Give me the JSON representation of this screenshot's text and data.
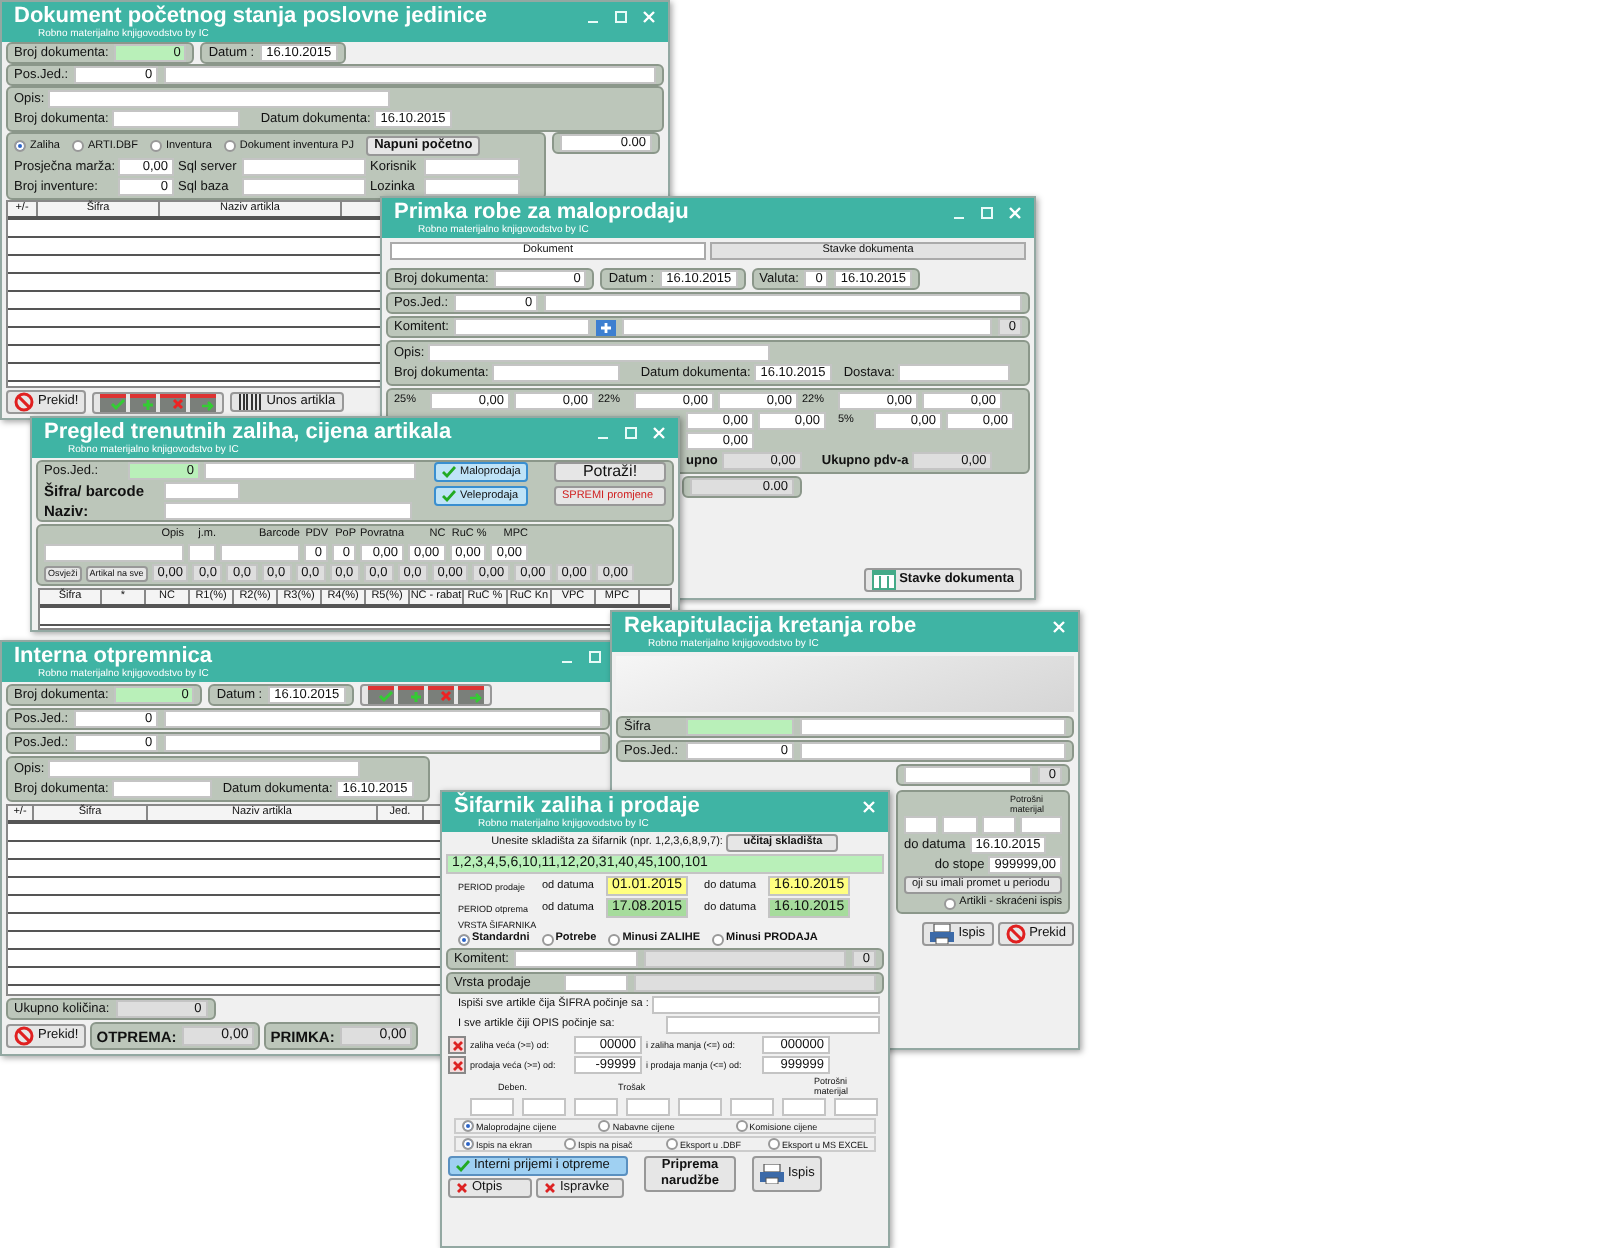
{
  "pocetno_stanje": {
    "title": "Dokument početnog stanja poslovne jedinice",
    "subtitle": "Robno materijalno knjigovodstvo by IC",
    "broj_dokumenta": {
      "label": "Broj dokumenta:",
      "value": "0"
    },
    "datum": {
      "label": "Datum :",
      "value": "16.10.2015"
    },
    "pos_jed": {
      "label": "Pos.Jed.:",
      "value": "0"
    },
    "opis_label": "Opis:",
    "broj_dok_label": "Broj dokumenta:",
    "datum_dok": {
      "label": "Datum dokumenta:",
      "value": "16.10.2015"
    },
    "options": [
      {
        "label": "Zaliha",
        "selected": true
      },
      {
        "label": "ARTI.DBF",
        "selected": false
      },
      {
        "label": "Inventura",
        "selected": false
      },
      {
        "label": "Dokument inventura PJ",
        "selected": false
      }
    ],
    "napuni_button": "Napuni početno",
    "total": "0.00",
    "marza": {
      "label": "Prosječna marža:",
      "value": "0,00"
    },
    "broj_inventure": {
      "label": "Broj inventure:",
      "value": "0"
    },
    "sql_server": "Sql server",
    "sql_baza": "Sql baza",
    "korisnik": "Korisnik",
    "lozinka": "Lozinka",
    "grid_columns": [
      "+/-",
      "Šifra",
      "Naziv artikla"
    ],
    "prekid_button": "Prekid!",
    "unos_button": "Unos artikla"
  },
  "primka": {
    "title": "Primka robe za maloprodaju",
    "subtitle": "Robno materijalno knjigovodstvo by IC",
    "tabs": [
      {
        "label": "Dokument",
        "selected": true
      },
      {
        "label": "Stavke dokumenta",
        "selected": false
      }
    ],
    "broj_dokumenta": {
      "label": "Broj dokumenta:",
      "value": "0"
    },
    "datum": {
      "label": "Datum :",
      "value": "16.10.2015"
    },
    "valuta": {
      "label": "Valuta:",
      "value": "0",
      "date": "16.10.2015"
    },
    "pos_jed": {
      "label": "Pos.Jed.:",
      "value": "0"
    },
    "komitent": {
      "label": "Komitent:",
      "value": "0"
    },
    "opis_label": "Opis:",
    "broj_dok_label": "Broj dokumenta:",
    "datum_dok": {
      "label": "Datum dokumenta:",
      "value": "16.10.2015"
    },
    "dostava_label": "Dostava:",
    "tax_top": [
      {
        "rate": "25%",
        "values": [
          "0,00",
          "0,00"
        ]
      },
      {
        "rate": "22%",
        "values": [
          "0,00",
          "0,00"
        ]
      },
      {
        "rate": "22%",
        "values": [
          "0,00",
          "0,00"
        ]
      }
    ],
    "tax_middle": [
      [
        "0,00",
        "0,00"
      ],
      [
        "0,00"
      ]
    ],
    "tax_right": {
      "rate": "5%",
      "values": [
        "0,00",
        "0,00"
      ]
    },
    "ukupno": {
      "label": "upno",
      "value": "0,00"
    },
    "ukupno_pdv": {
      "label": "Ukupno pdv-a",
      "value": "0,00"
    },
    "total": "0.00",
    "stavke_button": "Stavke dokumenta"
  },
  "pregled_zaliha": {
    "title": "Pregled trenutnih zaliha, cijena artikala",
    "subtitle": "Robno materijalno knjigovodstvo by IC",
    "pos_jed": {
      "label": "Pos.Jed.:",
      "value": "0"
    },
    "sifra_label": "Šifra/ barcode",
    "naziv_label": "Naziv:",
    "checks": [
      {
        "label": "Maloprodaja",
        "checked": true
      },
      {
        "label": "Veleprodaja",
        "checked": true
      }
    ],
    "potrazi_button": "Potraži!",
    "spremi_button": "SPREMI promjene",
    "fields": [
      {
        "label": "Opis"
      },
      {
        "label": "j.m."
      },
      {
        "label": "Barcode"
      },
      {
        "label": "PDV",
        "value": "0"
      },
      {
        "label": "PoP",
        "value": "0"
      },
      {
        "label": "Povratna",
        "value": "0,00"
      },
      {
        "label": "NC",
        "value": "0,00"
      },
      {
        "label": "RuC %",
        "value": "0,00"
      },
      {
        "label": "MPC",
        "value": "0,00"
      }
    ],
    "osvjezi_button": "Osvježi",
    "artikal_button": "Artikal na sve",
    "values": [
      "0,00",
      "0,0",
      "0,0",
      "0,0",
      "0,0",
      "0,0",
      "0,0",
      "0,0",
      "0,00",
      "0,00",
      "0,00",
      "0,00",
      "0,00"
    ],
    "grid_columns": [
      "Šifra",
      "*",
      "NC",
      "R1(%)",
      "R2(%)",
      "R3(%)",
      "R4(%)",
      "R5(%)",
      "NC - rabat",
      "RuC %",
      "RuC Kn",
      "VPC",
      "MPC"
    ]
  },
  "interna_otpremnica": {
    "title": "Interna otpremnica",
    "subtitle": "Robno materijalno knjigovodstvo by IC",
    "broj_dokumenta": {
      "label": "Broj dokumenta:",
      "value": "0"
    },
    "datum": {
      "label": "Datum :",
      "value": "16.10.2015"
    },
    "pos_jed": [
      {
        "label": "Pos.Jed.:",
        "value": "0"
      },
      {
        "label": "Pos.Jed.:",
        "value": "0"
      }
    ],
    "opis_label": "Opis:",
    "broj_dok_label": "Broj dokumenta:",
    "datum_dok": {
      "label": "Datum dokumenta:",
      "value": "16.10.2015"
    },
    "grid_columns": [
      "+/-",
      "Šifra",
      "Naziv artikla",
      "Jed."
    ],
    "ukupno": {
      "label": "Ukupno količina:",
      "value": "0"
    },
    "prekid_button": "Prekid!",
    "otprema": {
      "label": "OTPREMA:",
      "value": "0,00"
    },
    "primka": {
      "label": "PRIMKA:",
      "value": "0,00"
    }
  },
  "rekapitulacija": {
    "title": "Rekapitulacija kretanja robe",
    "subtitle": "Robno materijalno knjigovodstvo by IC",
    "sifra_label": "Šifra",
    "pos_jed": {
      "label": "Pos.Jed.:",
      "value": "0"
    },
    "komitent_value": "0",
    "potrosni_label": "Potrošni materijal",
    "do_datuma": {
      "label": "do datuma",
      "value": "16.10.2015"
    },
    "do_stope": {
      "label": "do stope",
      "value": "999999,00"
    },
    "promet_button": "oji su imali promet u periodu",
    "skraceni": {
      "label": "Artikli - skraćeni ispis",
      "selected": false
    },
    "ispis_button": "Ispis",
    "prekid_button": "Prekid"
  },
  "sifarnik": {
    "title": "Šifarnik zaliha i prodaje",
    "subtitle": "Robno materijalno knjigovodstvo by IC",
    "skladista_label": "Unesite skladišta za šifarnik (npr. 1,2,3,6,8,9,7):",
    "ucitaj_button": "učitaj skladišta",
    "skladista_value": "1,2,3,4,5,6,10,11,12,20,31,40,45,100,101",
    "periods": [
      {
        "label": "PERIOD prodaje",
        "od_label": "od datuma",
        "od": "01.01.2015",
        "do_label": "do datuma",
        "do": "16.10.2015",
        "color": "#ffff80"
      },
      {
        "label": "PERIOD otprema",
        "od_label": "od datuma",
        "od": "17.08.2015",
        "do_label": "do datuma",
        "do": "16.10.2015",
        "color": "#a6dc9c"
      }
    ],
    "vrsta_label": "VRSTA ŠIFARNIKA",
    "vrsta": [
      {
        "label": "Standardni",
        "selected": true
      },
      {
        "label": "Potrebe",
        "selected": false
      },
      {
        "label": "Minusi ZALIHE",
        "selected": false
      },
      {
        "label": "Minusi PRODAJA",
        "selected": false
      }
    ],
    "komitent": {
      "label": "Komitent:",
      "value": "0"
    },
    "vrsta_prodaje_label": "Vrsta prodaje",
    "ispisi_sifra_label": "Ispiši sve artikle čija ŠIFRA počinje sa :",
    "ispisi_opis_label": "I  sve artikle čiji OPIS počinje sa:",
    "filters": [
      {
        "checked": true,
        "label": "zaliha veća (>=) od:",
        "value": "00000",
        "label2": "i zaliha manja (<=) od:",
        "value2": "000000"
      },
      {
        "checked": true,
        "label": "prodaja  veća (>=) od:",
        "value": "-99999",
        "label2": "i prodaja manja (<=) od:",
        "value2": "999999"
      }
    ],
    "small_labels": [
      "Deben.",
      "Trošak",
      "Potrošni materijal"
    ],
    "cijene": [
      {
        "label": "Maloprodajne cijene",
        "selected": true
      },
      {
        "label": "Nabavne cijene",
        "selected": false
      },
      {
        "label": "Komisione cijene",
        "selected": false
      }
    ],
    "izlaz": [
      {
        "label": "Ispis na ekran",
        "selected": true
      },
      {
        "label": "Ispis na pisač",
        "selected": false
      },
      {
        "label": "Eksport u .DBF",
        "selected": false
      },
      {
        "label": "Eksport u MS EXCEL",
        "selected": false
      }
    ],
    "interni_button": "Interni prijemi i otpreme",
    "otpis_button": "Otpis",
    "ispravke_button": "Ispravke",
    "priprema_button": "Priprema narudžbe",
    "ispis_button": "Ispis"
  }
}
